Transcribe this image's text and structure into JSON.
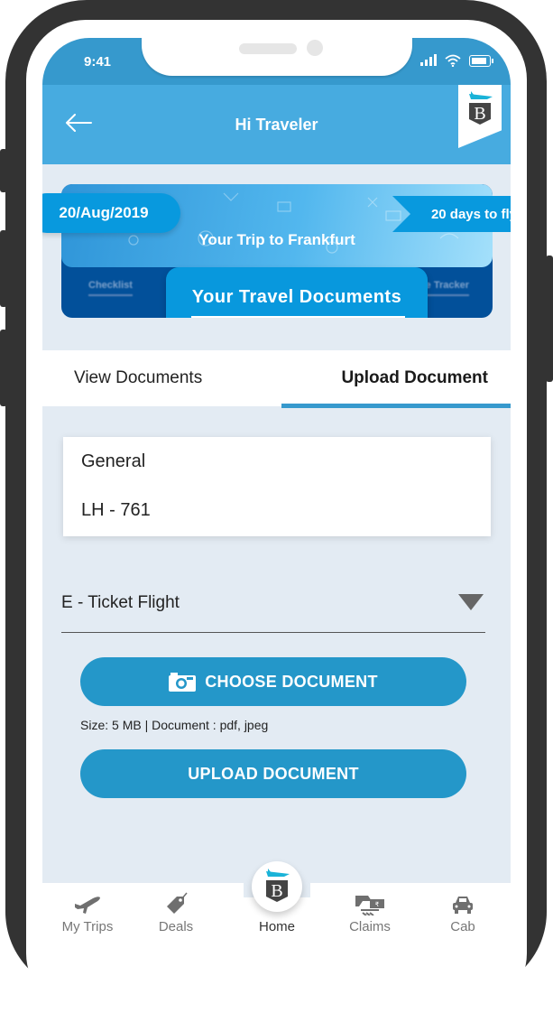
{
  "status_bar": {
    "time": "9:41"
  },
  "header": {
    "title": "Hi Traveler",
    "back_icon": "arrow-left-icon",
    "logo": "B"
  },
  "banner": {
    "date": "20/Aug/2019",
    "trip_title": "Your Trip to Frankfurt",
    "days_to_fly": "20 days to fly",
    "documents_card": "Your Travel Documents",
    "background_tabs": [
      "Checklist",
      "Expense Tracker"
    ]
  },
  "tabs": [
    {
      "label": "View Documents",
      "active": false
    },
    {
      "label": "Upload Document",
      "active": true
    }
  ],
  "info_card": {
    "category": "General",
    "flight": "LH - 761"
  },
  "document_type_select": {
    "value": "E - Ticket Flight"
  },
  "choose_button": {
    "label": "CHOOSE DOCUMENT",
    "icon": "camera-icon"
  },
  "hint": "Size: 5 MB | Document : pdf, jpeg",
  "upload_button": {
    "label": "UPLOAD DOCUMENT"
  },
  "bottom_nav": [
    {
      "label": "My Trips",
      "icon": "airplane-icon"
    },
    {
      "label": "Deals",
      "icon": "price-tag-icon"
    },
    {
      "label": "Home",
      "icon": "home-logo-icon",
      "active": true
    },
    {
      "label": "Claims",
      "icon": "claims-hand-money-icon"
    },
    {
      "label": "Cab",
      "icon": "car-icon"
    }
  ],
  "colors": {
    "primary": "#47abe0",
    "status_bar": "#3699cd",
    "button": "#2497c9",
    "accent": "#0899de",
    "banner_dark": "#02509a",
    "background": "#e3ebf3"
  }
}
